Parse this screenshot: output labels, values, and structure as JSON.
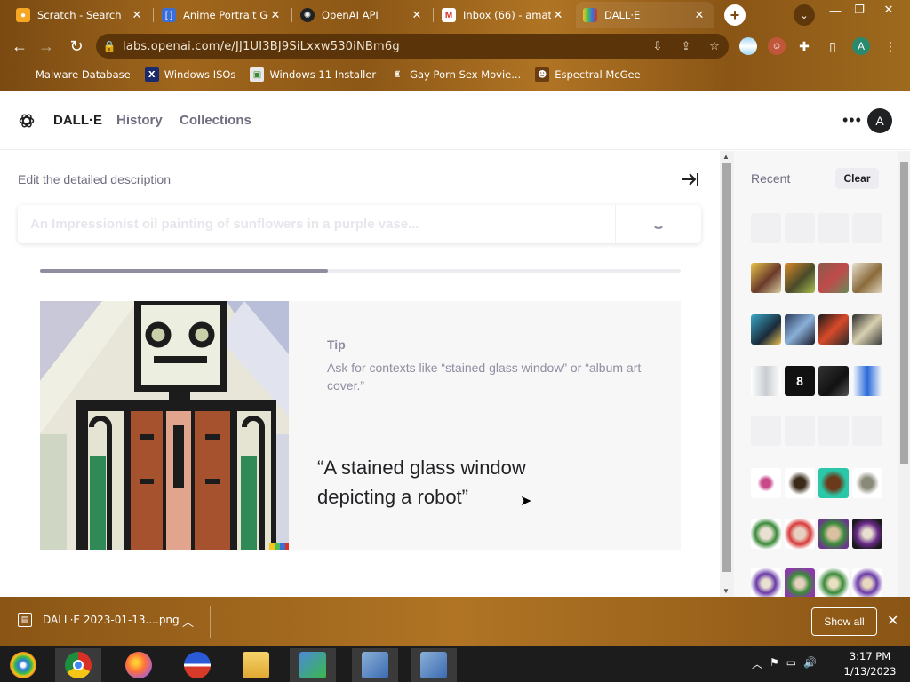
{
  "browser": {
    "tabs": [
      {
        "label": "Scratch - Search",
        "icon": "scratch-icon",
        "color": "#f6a623"
      },
      {
        "label": "Anime Portrait Ge",
        "icon": "code-icon",
        "color": "#3b6fd8"
      },
      {
        "label": "OpenAI API",
        "icon": "openai-icon",
        "color": "#202123"
      },
      {
        "label": "Inbox (66) - amat",
        "icon": "gmail-icon",
        "color": "#d93025"
      },
      {
        "label": "DALL·E",
        "icon": "dalle-icon",
        "color": "#f5c518"
      }
    ],
    "url": "labs.openai.com/e/JJ1UI3BJ9SiLxxw530iNBm6g",
    "profile_initial": "A",
    "bookmarks": [
      {
        "label": "Malware Database",
        "icon": "skull-icon"
      },
      {
        "label": "Windows ISOs",
        "icon": "x-icon"
      },
      {
        "label": "Windows 11 Installer",
        "icon": "image-icon"
      },
      {
        "label": "Gay Porn Sex Movie...",
        "icon": "robot-icon"
      },
      {
        "label": "Espectral McGee",
        "icon": "face-icon"
      }
    ]
  },
  "app": {
    "brand": "DALL·E",
    "nav": [
      "History",
      "Collections"
    ],
    "avatar_initial": "A",
    "edit_title": "Edit the detailed description",
    "prompt_placeholder": "An Impressionist oil painting of sunflowers in a purple vase...",
    "progress": 0.45,
    "tip_label": "Tip",
    "tip_text": "Ask for contexts like “stained glass window” or “album art cover.”",
    "quote": "“A stained glass window depicting a robot”",
    "recent_label": "Recent",
    "clear_label": "Clear"
  },
  "downloads": {
    "filename": "DALL·E 2023-01-13....png",
    "show_all": "Show all"
  },
  "taskbar": {
    "time": "3:17 PM",
    "date": "1/13/2023"
  },
  "colors": {
    "chrome_brown": "#8c5716",
    "accent_dark": "#202123",
    "muted": "#8e8ea0"
  }
}
